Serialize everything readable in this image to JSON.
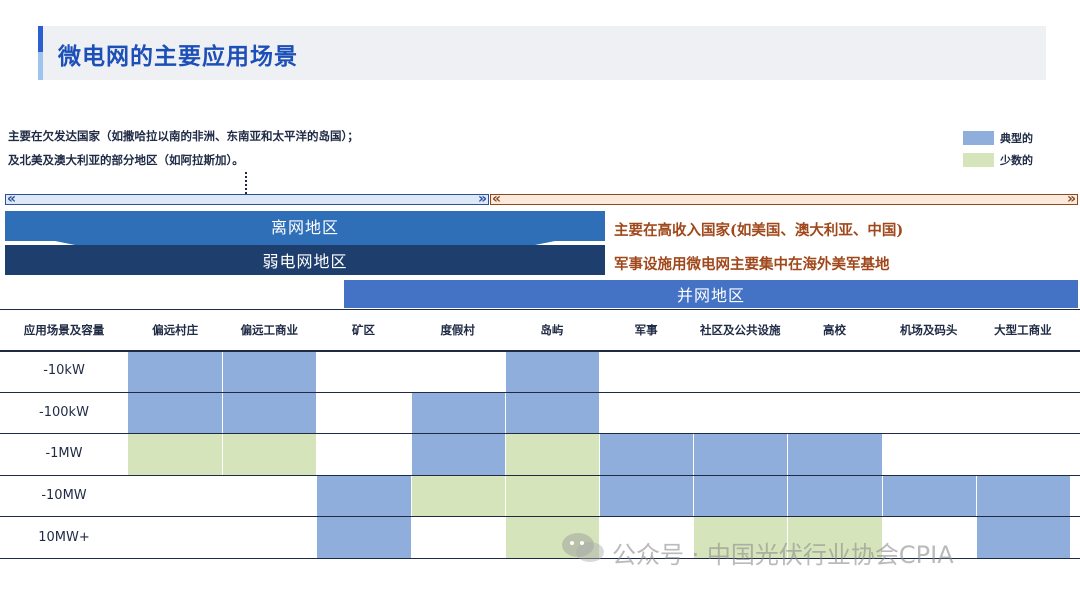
{
  "header": {
    "title": "微电网的主要应用场景"
  },
  "notes": {
    "line1": "主要在欠发达国家（如撒哈拉以南的非洲、东南亚和太平洋的岛国）；",
    "line2": "及北美及澳大利亚的部分地区（如阿拉斯加）。",
    "offgrid_note": "主要在高收入国家(如美国、澳大利亚、中国)",
    "military_note": "军事设施用微电网主要集中在海外美军基地"
  },
  "legend": {
    "typical": {
      "label": "典型的",
      "color": "#8faedb"
    },
    "few": {
      "label": "少数的",
      "color": "#d6e4bc"
    }
  },
  "regions": {
    "offgrid": "离网地区",
    "weakgrid": "弱电网地区",
    "gridconnected": "并网地区"
  },
  "colors": {
    "offgrid_band": "#2f6fb8",
    "weakgrid_band": "#1e3f6e",
    "gridconn_band": "#4472c4",
    "orange_text": "#a0481b"
  },
  "table": {
    "corner": "应用场景及容量",
    "columns": [
      "偏远村庄",
      "偏远工商业",
      "矿区",
      "度假村",
      "岛屿",
      "军事",
      "社区及公共设施",
      "高校",
      "机场及码头",
      "大型工商业"
    ],
    "rows": [
      {
        "label": "-10kW",
        "cells": [
          "typical",
          "typical",
          "",
          "",
          "typical",
          "",
          "",
          "",
          "",
          ""
        ]
      },
      {
        "label": "-100kW",
        "cells": [
          "typical",
          "typical",
          "",
          "typical",
          "typical",
          "",
          "",
          "",
          "",
          ""
        ]
      },
      {
        "label": "-1MW",
        "cells": [
          "few",
          "few",
          "",
          "typical",
          "few",
          "typical",
          "typical",
          "typical",
          "",
          ""
        ]
      },
      {
        "label": "-10MW",
        "cells": [
          "",
          "",
          "typical",
          "few",
          "few",
          "typical",
          "typical",
          "typical",
          "typical",
          "typical"
        ]
      },
      {
        "label": "10MW+",
        "cells": [
          "",
          "",
          "typical",
          "",
          "few",
          "",
          "few",
          "few",
          "",
          "typical"
        ]
      }
    ]
  },
  "watermark": {
    "text": "公众号 · 中国光伏行业协会CPIA",
    "icon": "wechat-icon"
  }
}
